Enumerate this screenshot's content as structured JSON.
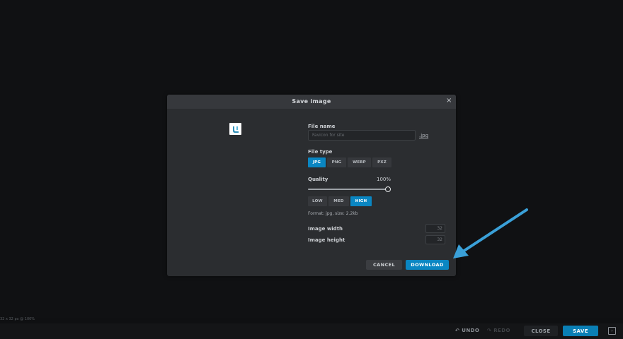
{
  "status": {
    "info": "32 x 32 px @ 100%"
  },
  "bottombar": {
    "undo_label": "UNDO",
    "redo_label": "REDO",
    "close_label": "CLOSE",
    "save_label": "SAVE"
  },
  "dialog": {
    "title": "Save image",
    "close_glyph": "×",
    "file_name": {
      "label": "File name",
      "placeholder": "Favicon for site",
      "extension": ".jpg"
    },
    "file_type": {
      "label": "File type",
      "options": [
        "JPG",
        "PNG",
        "WEBP",
        "PXZ"
      ],
      "selected": "JPG"
    },
    "quality": {
      "label": "Quality",
      "value_text": "100%",
      "value": 100,
      "presets": [
        "LOW",
        "MED",
        "HIGH"
      ],
      "selected_preset": "HIGH"
    },
    "format_info": "Format: jpg, size: 2.2kb",
    "image_width": {
      "label": "Image width",
      "value": "32"
    },
    "image_height": {
      "label": "Image height",
      "value": "32"
    },
    "cancel_label": "CANCEL",
    "download_label": "DOWNLOAD"
  },
  "colors": {
    "accent": "#0a86c2",
    "annotation_arrow": "#3aa0d8"
  },
  "icons": {
    "undo": "undo-icon",
    "redo": "redo-icon",
    "close": "close-icon",
    "sidebar_toggle": "panel-toggle-icon",
    "preview": "favicon-preview"
  }
}
